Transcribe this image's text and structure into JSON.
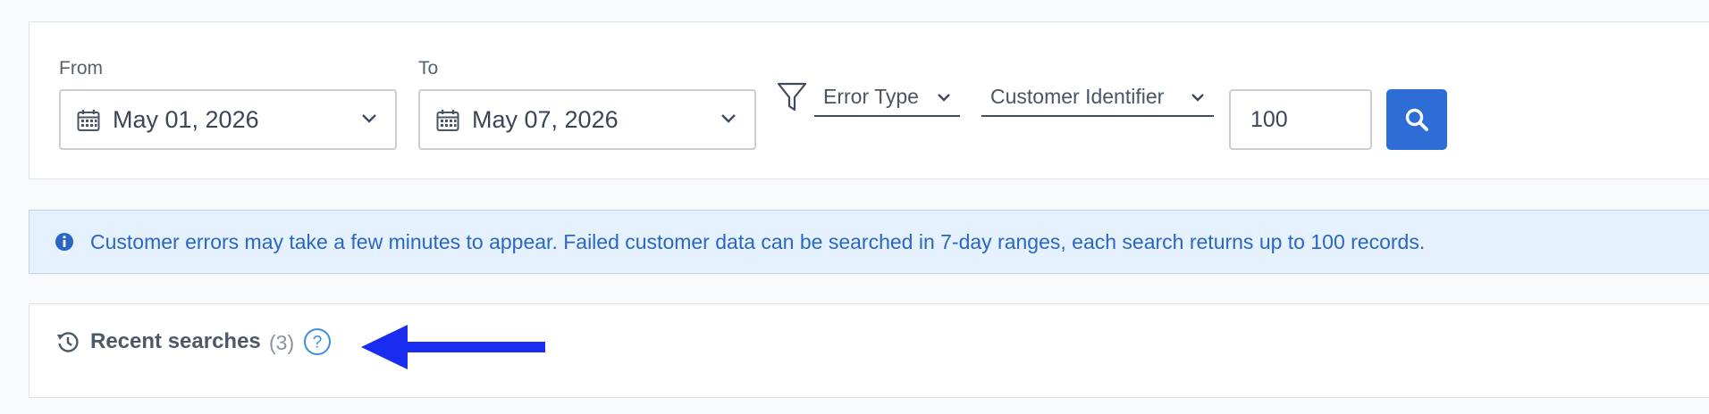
{
  "filters": {
    "from_label": "From",
    "from_value": "May 01, 2026",
    "to_label": "To",
    "to_value": "May 07, 2026",
    "error_type_label": "Error Type",
    "customer_identifier_label": "Customer Identifier",
    "limit_value": "100",
    "icons": {
      "calendar": "calendar-icon",
      "chevron": "chevron-down-icon",
      "filter": "filter-icon",
      "search": "search-icon"
    }
  },
  "info_banner": {
    "icon": "info-icon",
    "message": "Customer errors may take a few minutes to appear. Failed customer data can be searched in 7-day ranges, each search returns up to 100 records."
  },
  "recent_searches": {
    "icon": "history-icon",
    "title": "Recent searches",
    "count": "(3)",
    "help_icon": "help-icon"
  },
  "colors": {
    "accent": "#2f6dd6",
    "info_background": "#e5f1fc",
    "info_text": "#2a66c4",
    "annotation_arrow": "#1a2cf0"
  }
}
